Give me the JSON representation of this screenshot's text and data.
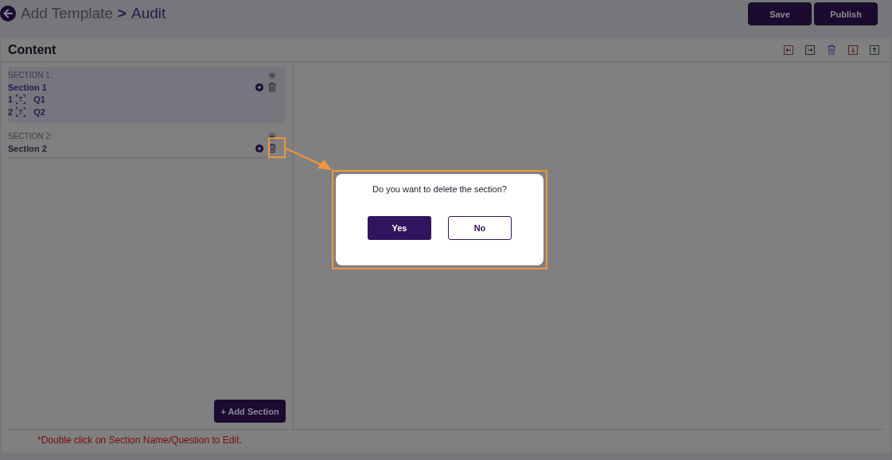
{
  "header": {
    "breadcrumb_parent": "Add Template",
    "separator": ">",
    "breadcrumb_current": "Audit",
    "buttons": [
      "Save",
      "Publish"
    ]
  },
  "content": {
    "title": "Content",
    "sections": [
      {
        "label": "SECTION 1:",
        "name": "Section 1",
        "expanded": true,
        "selected": true,
        "questions": [
          {
            "number": "1",
            "text": "Q1"
          },
          {
            "number": "2",
            "text": "Q2"
          }
        ]
      },
      {
        "label": "SECTION 2:",
        "name": "Section 2",
        "expanded": false,
        "selected": false
      }
    ],
    "add_section_button": "+ Add Section"
  },
  "hint": "*Double click on Section Name/Question to Edit.",
  "dialog": {
    "message": "Do you want to delete the section?",
    "confirm": "Yes",
    "cancel": "No"
  }
}
